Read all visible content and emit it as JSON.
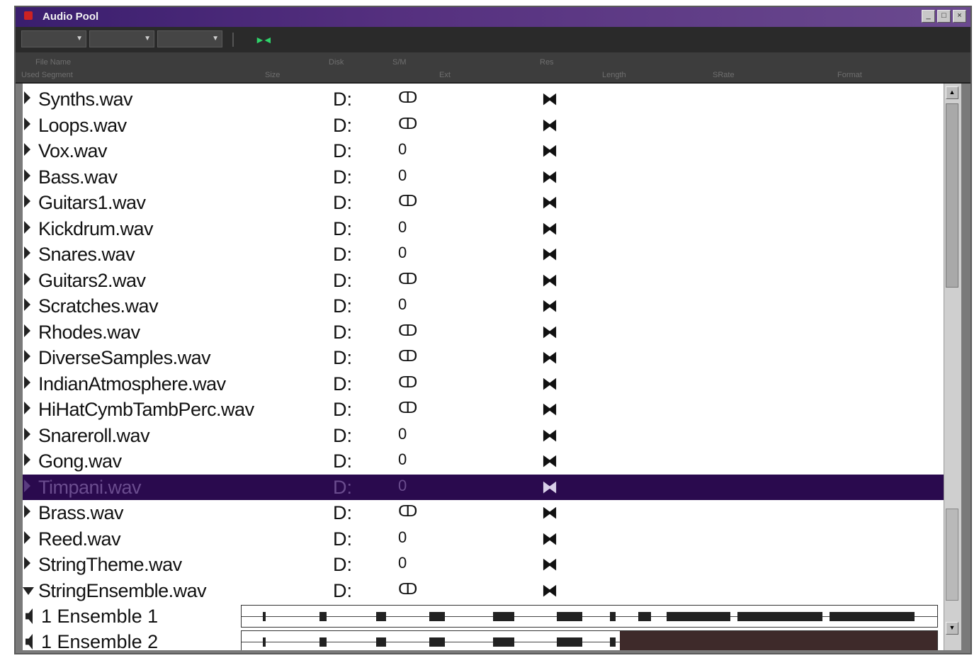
{
  "window": {
    "title": "Audio Pool",
    "buttons": [
      "_",
      "□",
      "×"
    ]
  },
  "toolbar": {
    "dropdown1": "",
    "dropdown2": "",
    "dropdown3": "",
    "play_icon": "play-icon"
  },
  "columns": {
    "filename": "File Name",
    "row2_left": "Used  Segment",
    "size": "Size",
    "disk": "Disk",
    "stereo": "S/M",
    "ext": "Ext",
    "res": "Res",
    "length": "Length",
    "rate": "SRate",
    "format": "Format"
  },
  "rows": [
    {
      "name": "Synths.wav",
      "drive": "D:",
      "channels": "ↀ",
      "status": "⧓"
    },
    {
      "name": "Loops.wav",
      "drive": "D:",
      "channels": "ↀ",
      "status": "⧓"
    },
    {
      "name": "Vox.wav",
      "drive": "D:",
      "channels": "0",
      "status": "⧓"
    },
    {
      "name": "Bass.wav",
      "drive": "D:",
      "channels": "0",
      "status": "⧓"
    },
    {
      "name": "Guitars1.wav",
      "drive": "D:",
      "channels": "ↀ",
      "status": "⧓"
    },
    {
      "name": "Kickdrum.wav",
      "drive": "D:",
      "channels": "0",
      "status": "⧓"
    },
    {
      "name": "Snares.wav",
      "drive": "D:",
      "channels": "0",
      "status": "⧓"
    },
    {
      "name": "Guitars2.wav",
      "drive": "D:",
      "channels": "ↀ",
      "status": "⧓"
    },
    {
      "name": "Scratches.wav",
      "drive": "D:",
      "channels": "0",
      "status": "⧓"
    },
    {
      "name": "Rhodes.wav",
      "drive": "D:",
      "channels": "ↀ",
      "status": "⧓"
    },
    {
      "name": "DiverseSamples.wav",
      "drive": "D:",
      "channels": "ↀ",
      "status": "⧓"
    },
    {
      "name": "IndianAtmosphere.wav",
      "drive": "D:",
      "channels": "ↀ",
      "status": "⧓"
    },
    {
      "name": "HiHatCymbTambPerc.wav",
      "drive": "D:",
      "channels": "ↀ",
      "status": "⧓"
    },
    {
      "name": "Snareroll.wav",
      "drive": "D:",
      "channels": "0",
      "status": "⧓"
    },
    {
      "name": "Gong.wav",
      "drive": "D:",
      "channels": "0",
      "status": "⧓"
    },
    {
      "name": "Timpani.wav",
      "drive": "D:",
      "channels": "0",
      "status": "⧓",
      "selected": true
    },
    {
      "name": "Brass.wav",
      "drive": "D:",
      "channels": "ↀ",
      "status": "⧓"
    },
    {
      "name": "Reed.wav",
      "drive": "D:",
      "channels": "0",
      "status": "⧓"
    },
    {
      "name": "StringTheme.wav",
      "drive": "D:",
      "channels": "0",
      "status": "⧓"
    },
    {
      "name": "StringEnsemble.wav",
      "drive": "D:",
      "channels": "ↀ",
      "status": "⧓",
      "expanded": true
    }
  ],
  "segments": [
    {
      "label": "1 Ensemble 1",
      "fill": 1.0
    },
    {
      "label": "1 Ensemble 2",
      "fill": 0.545
    }
  ]
}
